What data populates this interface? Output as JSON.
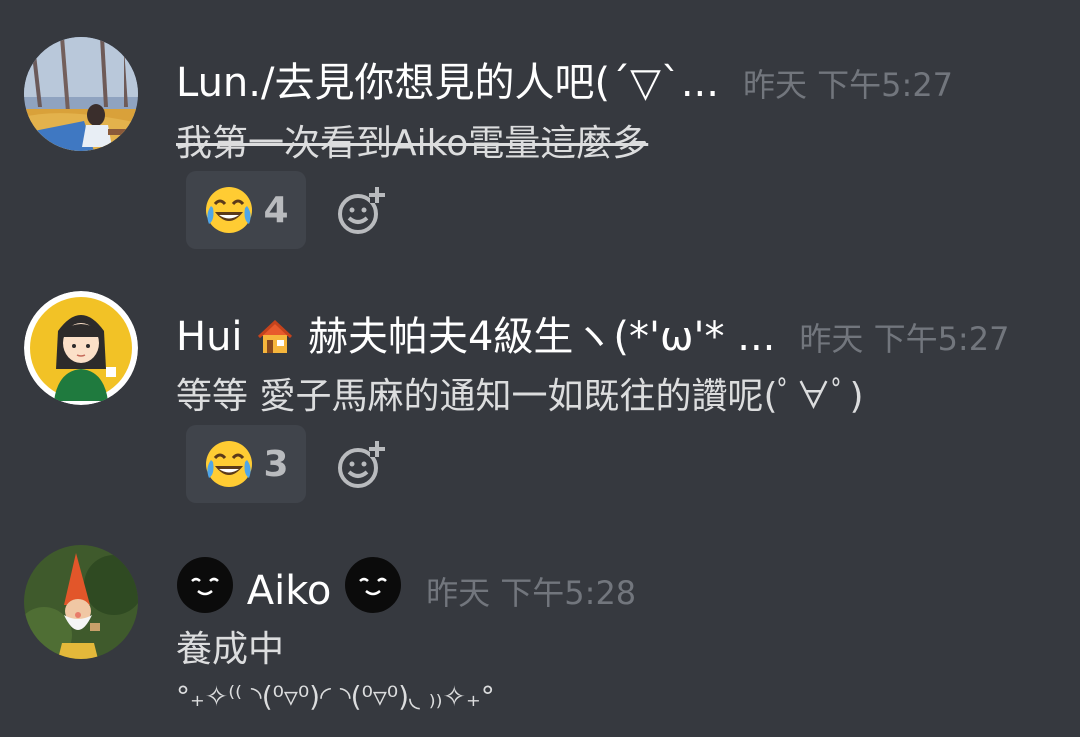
{
  "messages": [
    {
      "username": "Lun./去見你想見的人吧(´▽`...",
      "timestamp": "昨天 下午5:27",
      "content": "我第一次看到Aiko電量這麼多",
      "reaction": {
        "emoji": "face-with-tears-of-joy",
        "count": "4"
      }
    },
    {
      "username_prefix": "Hui",
      "username_suffix": "赫夫帕夫4級生ヽ(*'ω'* ...",
      "username_emoji": "house",
      "timestamp": "昨天 下午5:27",
      "content": "等等 愛子馬麻的通知一如既往的讚呢(ﾟ∀ﾟ)",
      "reaction": {
        "emoji": "face-with-tears-of-joy",
        "count": "3"
      }
    },
    {
      "username": "Aiko",
      "username_emoji": "black-smiley",
      "timestamp": "昨天 下午5:28",
      "content": "養成中",
      "extra": "°₊✧⁽⁽ ◝(⁰▿⁰)◜ ◝(⁰▿⁰)◟ ₎₎✧₊°"
    }
  ],
  "colors": {
    "background": "#36393f",
    "username": "#ffffff",
    "timestamp": "#72767d",
    "text": "#dcddde",
    "reaction_bg": "#40444b"
  }
}
